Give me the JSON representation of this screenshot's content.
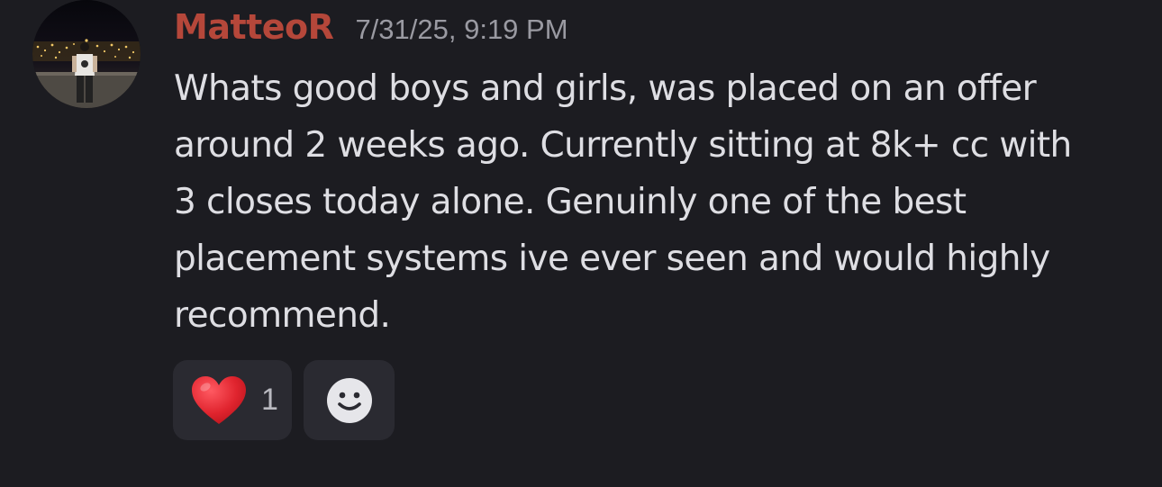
{
  "message": {
    "username": "MatteoR",
    "timestamp": "7/31/25, 9:19 PM",
    "text": "Whats good boys and girls, was placed on an offer\naround 2 weeks ago. Currently sitting at 8k+ cc with\n3 closes today alone. Genuinly one of the best\nplacement systems ive ever seen and would highly\nrecommend.",
    "avatar": {
      "icon": "user-avatar-photo"
    }
  },
  "reactions": [
    {
      "emoji": "heart-emoji",
      "count": "1"
    }
  ],
  "add_reaction": {
    "icon": "smiley-face-icon"
  },
  "colors": {
    "background": "#1c1c21",
    "username": "#b5473a",
    "timestamp": "#9a9aa2",
    "text": "#dedee3",
    "reaction_bg": "#2a2a31",
    "heart": "#e0242e"
  }
}
